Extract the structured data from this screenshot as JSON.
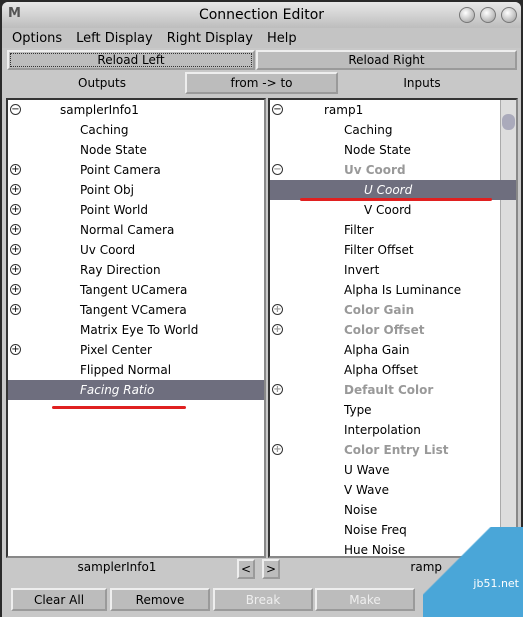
{
  "window": {
    "title": "Connection Editor"
  },
  "menu": [
    "Options",
    "Left Display",
    "Right Display",
    "Help"
  ],
  "toolbar": {
    "reload_left": "Reload Left",
    "reload_right": "Reload Right",
    "outputs": "Outputs",
    "from_to": "from -> to",
    "inputs": "Inputs"
  },
  "left": {
    "items": [
      {
        "label": "samplerInfo1",
        "indent": 0,
        "expander": "minus"
      },
      {
        "label": "Caching",
        "indent": 1
      },
      {
        "label": "Node State",
        "indent": 1
      },
      {
        "label": "Point Camera",
        "indent": 1,
        "expander": "plus"
      },
      {
        "label": "Point Obj",
        "indent": 1,
        "expander": "plus"
      },
      {
        "label": "Point World",
        "indent": 1,
        "expander": "plus"
      },
      {
        "label": "Normal Camera",
        "indent": 1,
        "expander": "plus"
      },
      {
        "label": "Uv Coord",
        "indent": 1,
        "expander": "plus"
      },
      {
        "label": "Ray Direction",
        "indent": 1,
        "expander": "plus"
      },
      {
        "label": "Tangent UCamera",
        "indent": 1,
        "expander": "plus"
      },
      {
        "label": "Tangent VCamera",
        "indent": 1,
        "expander": "plus"
      },
      {
        "label": "Matrix Eye To World",
        "indent": 1
      },
      {
        "label": "Pixel Center",
        "indent": 1,
        "expander": "plus"
      },
      {
        "label": "Flipped Normal",
        "indent": 1
      },
      {
        "label": "Facing Ratio",
        "indent": 1,
        "selected": true
      }
    ],
    "node": "samplerInfo1"
  },
  "right": {
    "items": [
      {
        "label": "ramp1",
        "indent": 0,
        "expander": "minus"
      },
      {
        "label": "Caching",
        "indent": 1
      },
      {
        "label": "Node State",
        "indent": 1
      },
      {
        "label": "Uv Coord",
        "indent": 1,
        "expander": "minus",
        "grey": true
      },
      {
        "label": "U Coord",
        "indent": 2,
        "selected": true
      },
      {
        "label": "V Coord",
        "indent": 2
      },
      {
        "label": "Filter",
        "indent": 1
      },
      {
        "label": "Filter Offset",
        "indent": 1
      },
      {
        "label": "Invert",
        "indent": 1
      },
      {
        "label": "Alpha Is Luminance",
        "indent": 1
      },
      {
        "label": "Color Gain",
        "indent": 1,
        "expander": "plus",
        "grey": true
      },
      {
        "label": "Color Offset",
        "indent": 1,
        "expander": "plus",
        "grey": true
      },
      {
        "label": "Alpha Gain",
        "indent": 1
      },
      {
        "label": "Alpha Offset",
        "indent": 1
      },
      {
        "label": "Default Color",
        "indent": 1,
        "expander": "plus",
        "grey": true
      },
      {
        "label": "Type",
        "indent": 1
      },
      {
        "label": "Interpolation",
        "indent": 1
      },
      {
        "label": "Color Entry List",
        "indent": 1,
        "expander": "plus",
        "grey": true
      },
      {
        "label": "U Wave",
        "indent": 1
      },
      {
        "label": "V Wave",
        "indent": 1
      },
      {
        "label": "Noise",
        "indent": 1
      },
      {
        "label": "Noise Freq",
        "indent": 1
      },
      {
        "label": "Hue Noise",
        "indent": 1
      }
    ],
    "node": "ramp"
  },
  "nav": {
    "prev": "<",
    "next": ">"
  },
  "buttons": {
    "clear_all": "Clear All",
    "remove": "Remove",
    "break": "Break",
    "make": "Make"
  },
  "watermark": "jb51.net"
}
